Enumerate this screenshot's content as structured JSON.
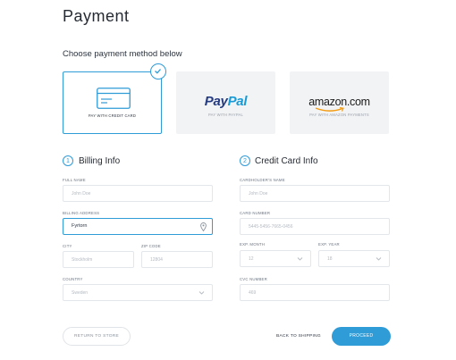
{
  "page": {
    "title": "Payment",
    "subtitle": "Choose payment method below"
  },
  "methods": [
    {
      "caption": "PAY WITH CREDIT CARD",
      "selected": true
    },
    {
      "logo_left": "Pay",
      "logo_right": "Pal",
      "caption": "PAY WITH PAYPAL",
      "selected": false
    },
    {
      "logo": "amazon.com",
      "caption": "PAY WITH AMAZON PAYMENTS",
      "selected": false
    }
  ],
  "billing": {
    "number": "1",
    "title": "Billing Info",
    "full_name": {
      "label": "FULL NAME",
      "value": "John Doe"
    },
    "address": {
      "label": "BILLING ADDRESS",
      "value": "Fyrtorn"
    },
    "city": {
      "label": "CITY",
      "value": "Stockholm"
    },
    "zip": {
      "label": "ZIP CODE",
      "value": "12804"
    },
    "country": {
      "label": "COUNTRY",
      "value": "Sweden"
    }
  },
  "card": {
    "number": "2",
    "title": "Credit Card Info",
    "holder": {
      "label": "CARDHOLDER'S NAME",
      "value": "John Doe"
    },
    "card_number": {
      "label": "CARD NUMBER",
      "value": "5445-5456-7665-0456"
    },
    "exp_month": {
      "label": "EXP. MONTH",
      "value": "12"
    },
    "exp_year": {
      "label": "EXP. YEAR",
      "value": "18"
    },
    "cvc": {
      "label": "CVC NUMBER",
      "value": "469"
    }
  },
  "buttons": {
    "return": "RETURN TO STORE",
    "back": "BACK TO SHIPPING",
    "proceed": "PROCEED"
  },
  "colors": {
    "accent": "#2f9bd7",
    "paypal_dark": "#253b80",
    "paypal_light": "#179bd7"
  }
}
